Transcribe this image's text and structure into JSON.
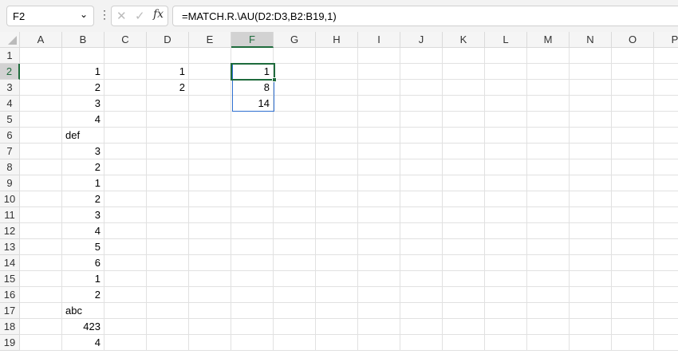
{
  "name_box": {
    "value": "F2"
  },
  "formula_bar": {
    "value": "=MATCH.R.\\AU(D2:D3,B2:B19,1)",
    "fx_label": "fx"
  },
  "columns": [
    "A",
    "B",
    "C",
    "D",
    "E",
    "F",
    "G",
    "H",
    "I",
    "J",
    "K",
    "L",
    "M",
    "N",
    "O",
    "P"
  ],
  "rows": [
    "1",
    "2",
    "3",
    "4",
    "5",
    "6",
    "7",
    "8",
    "9",
    "10",
    "11",
    "12",
    "13",
    "14",
    "15",
    "16",
    "17",
    "18",
    "19"
  ],
  "selected": {
    "column": "F",
    "row": "2"
  },
  "cells": {
    "B2": {
      "v": "1",
      "t": "n"
    },
    "B3": {
      "v": "2",
      "t": "n"
    },
    "B4": {
      "v": "3",
      "t": "n"
    },
    "B5": {
      "v": "4",
      "t": "n"
    },
    "B6": {
      "v": "def",
      "t": "s"
    },
    "B7": {
      "v": "3",
      "t": "n"
    },
    "B8": {
      "v": "2",
      "t": "n"
    },
    "B9": {
      "v": "1",
      "t": "n"
    },
    "B10": {
      "v": "2",
      "t": "n"
    },
    "B11": {
      "v": "3",
      "t": "n"
    },
    "B12": {
      "v": "4",
      "t": "n"
    },
    "B13": {
      "v": "5",
      "t": "n"
    },
    "B14": {
      "v": "6",
      "t": "n"
    },
    "B15": {
      "v": "1",
      "t": "n"
    },
    "B16": {
      "v": "2",
      "t": "n"
    },
    "B17": {
      "v": "abc",
      "t": "s"
    },
    "B18": {
      "v": "423",
      "t": "n"
    },
    "B19": {
      "v": "4",
      "t": "n"
    },
    "D2": {
      "v": "1",
      "t": "n"
    },
    "D3": {
      "v": "2",
      "t": "n"
    },
    "F2": {
      "v": "1",
      "t": "n"
    },
    "F3": {
      "v": "8",
      "t": "n"
    },
    "F4": {
      "v": "14",
      "t": "n"
    }
  }
}
